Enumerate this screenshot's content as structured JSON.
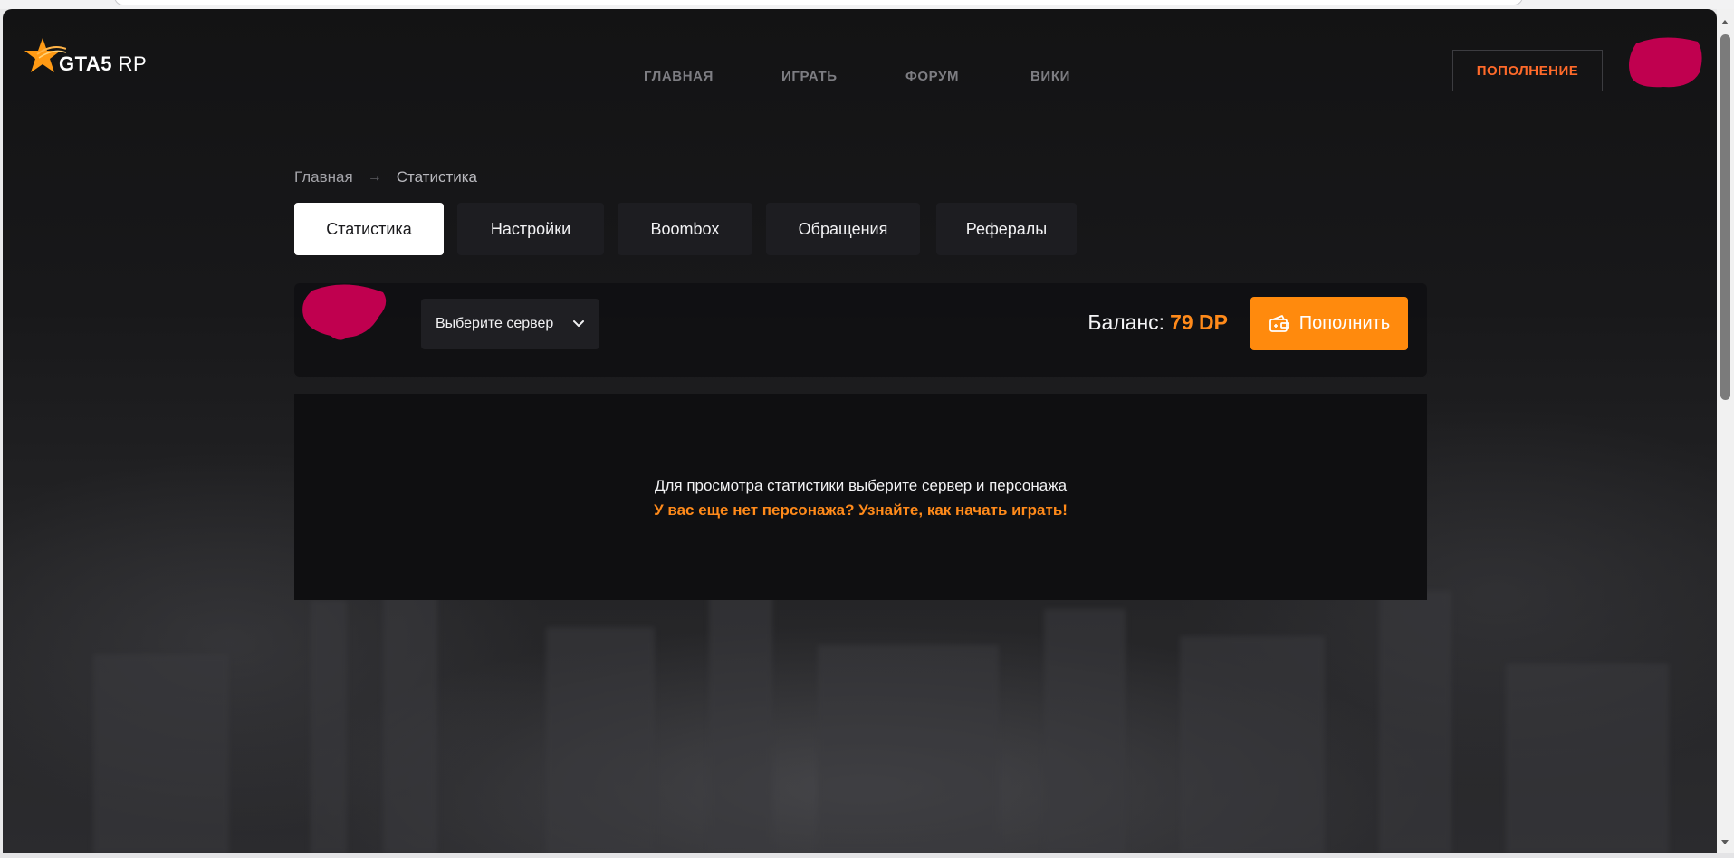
{
  "header": {
    "logo_text": "GTA5",
    "logo_suffix": "RP",
    "nav": [
      "ГЛАВНАЯ",
      "ИГРАТЬ",
      "ФОРУМ",
      "ВИКИ"
    ],
    "topup_label": "ПОПОЛНЕНИЕ"
  },
  "breadcrumb": {
    "home": "Главная",
    "current": "Статистика"
  },
  "tabs": [
    {
      "label": "Статистика",
      "active": true
    },
    {
      "label": "Настройки",
      "active": false
    },
    {
      "label": "Boombox",
      "active": false
    },
    {
      "label": "Обращения",
      "active": false
    },
    {
      "label": "Рефералы",
      "active": false
    }
  ],
  "account": {
    "server_select_label": "Выберите сервер",
    "balance_label": "Баланс:",
    "balance_value": "79 DP",
    "pay_button": "Пополнить"
  },
  "stats_panel": {
    "message": "Для просмотра статистики выберите сервер и персонажа",
    "link_text": "У вас еще нет персонажа? Узнайте, как начать играть!"
  },
  "colors": {
    "accent_orange": "#ff8a0d",
    "topup_text": "#ff6a2a",
    "redaction": "#c0004f"
  },
  "icons": {
    "logo": "star-logo-icon",
    "chevron": "chevron-down-icon",
    "wallet": "wallet-icon"
  }
}
